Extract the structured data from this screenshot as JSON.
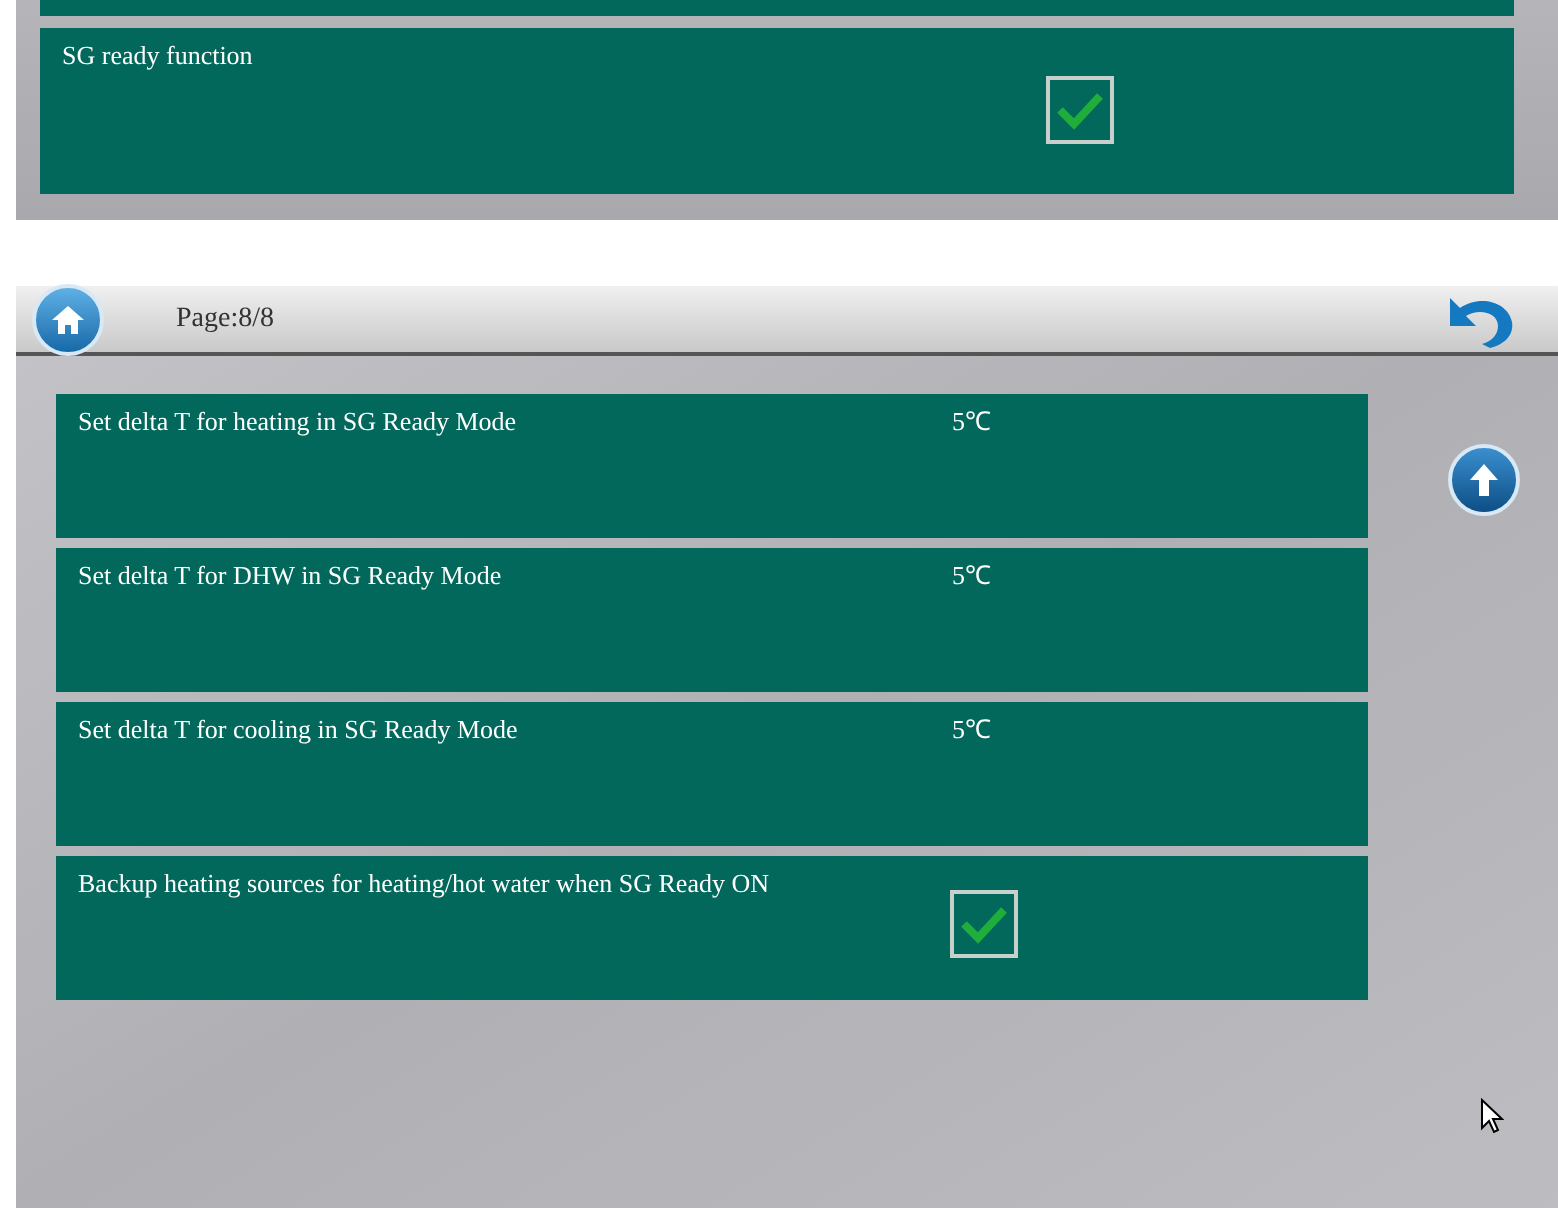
{
  "top_panel": {
    "settings": [
      {
        "kind": "checkbox",
        "label": "SG ready function",
        "checked": true
      }
    ]
  },
  "screen": {
    "header": {
      "page": "Page:8/8"
    },
    "settings": [
      {
        "kind": "value",
        "label": "Set delta T for heating in SG Ready Mode",
        "value": "5℃"
      },
      {
        "kind": "value",
        "label": "Set delta T for DHW in SG Ready Mode",
        "value": "5℃"
      },
      {
        "kind": "value",
        "label": "Set delta T for cooling in SG Ready Mode",
        "value": "5℃"
      },
      {
        "kind": "checkbox",
        "label": "Backup heating sources for heating/hot water when SG Ready ON",
        "checked": true
      }
    ]
  }
}
